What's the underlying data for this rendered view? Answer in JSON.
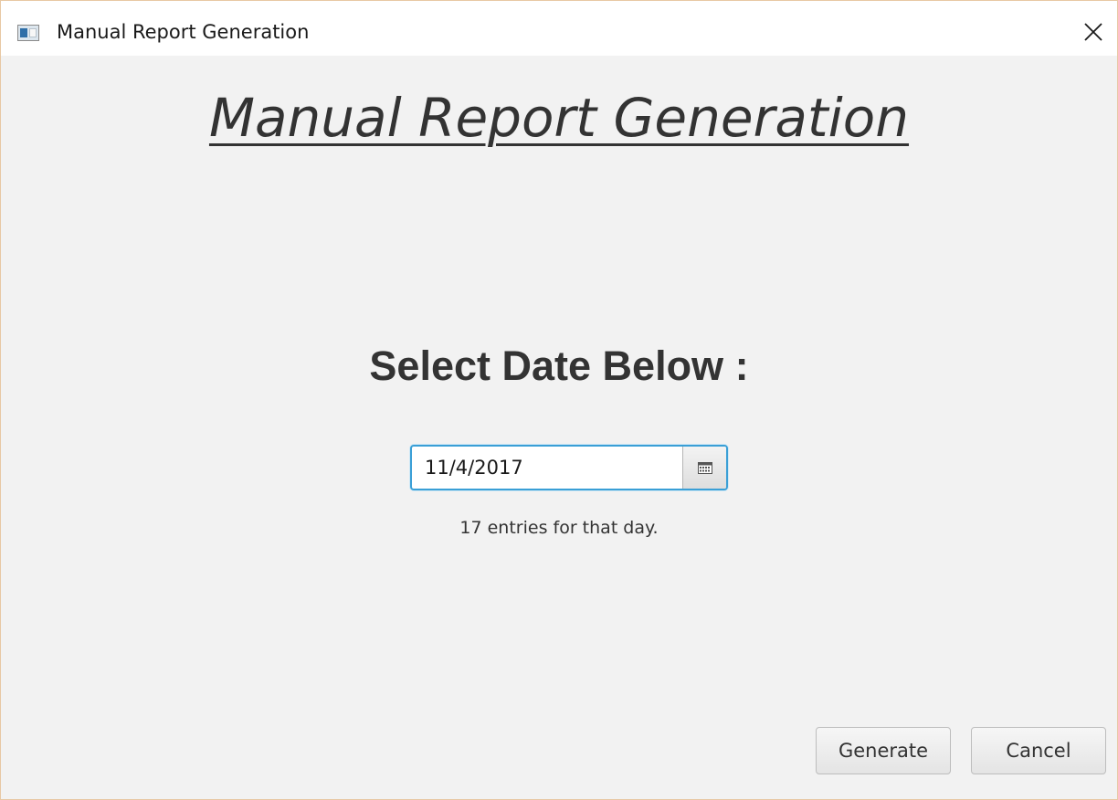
{
  "window": {
    "title": "Manual Report Generation"
  },
  "main": {
    "heading": "Manual Report Generation",
    "subheading": "Select Date Below :",
    "date_picker": {
      "value": "11/4/2017"
    },
    "entries_text": "17 entries for that day."
  },
  "actions": {
    "generate_label": "Generate",
    "cancel_label": "Cancel"
  },
  "icons": {
    "app": "window-app-icon",
    "close": "close-icon",
    "calendar": "calendar-icon"
  },
  "colors": {
    "focus_border": "#3a9fd6",
    "background": "#f2f2f2",
    "text": "#333333"
  }
}
